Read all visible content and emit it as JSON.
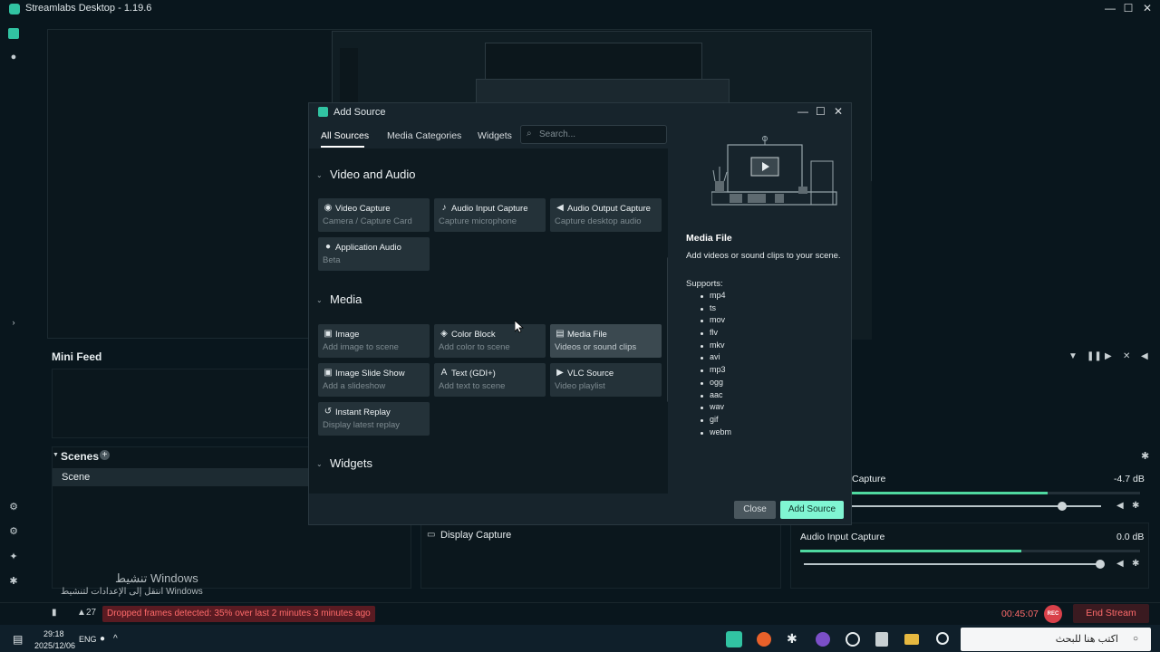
{
  "window": {
    "title": "Streamlabs Desktop - 1.19.6",
    "minimize": "—",
    "maximize": "☐",
    "close": "✕"
  },
  "mini_feed": {
    "title": "Mini Feed"
  },
  "scenes": {
    "title": "Scenes",
    "items": [
      "Scene"
    ]
  },
  "sources_preview": {
    "item": "Display Capture"
  },
  "mixer": {
    "items": [
      {
        "label": "Capture",
        "db": "-4.7 dB",
        "level": 0.68
      },
      {
        "label": "Audio Input Capture",
        "db": "0.0 dB",
        "level": 0.65
      }
    ]
  },
  "status": {
    "dropped_count": "27",
    "dropped_message": "Dropped frames detected: 35% over last 2 minutes 3 minutes ago",
    "rec_time": "00:45:07",
    "rec_label": "REC",
    "end_stream": "End Stream"
  },
  "watermark": {
    "line1": "تنشيط Windows",
    "line2": "انتقل إلى الإعدادات لتنشيط Windows"
  },
  "taskbar": {
    "time": "29:18",
    "date": "2025/12/06",
    "lang": "ENG",
    "search_placeholder": "اكتب هنا للبحث"
  },
  "dialog": {
    "title": "Add Source",
    "tabs": [
      "All Sources",
      "Media Categories",
      "Widgets"
    ],
    "active_tab": 0,
    "search_placeholder": "Search...",
    "sections": [
      {
        "title": "Video and Audio",
        "cards": [
          {
            "name": "Video Capture",
            "desc": "Camera / Capture Card",
            "icon": "camera-icon"
          },
          {
            "name": "Audio Input Capture",
            "desc": "Capture microphone",
            "icon": "microphone-icon"
          },
          {
            "name": "Audio Output Capture",
            "desc": "Capture desktop audio",
            "icon": "speaker-icon"
          },
          {
            "name": "Application Audio",
            "desc": "Beta",
            "icon": "user-icon"
          }
        ]
      },
      {
        "title": "Media",
        "cards": [
          {
            "name": "Image",
            "desc": "Add image to scene",
            "icon": "image-icon"
          },
          {
            "name": "Color Block",
            "desc": "Add color to scene",
            "icon": "paint-bucket-icon"
          },
          {
            "name": "Media File",
            "desc": "Videos or sound clips",
            "icon": "file-icon",
            "active": true
          },
          {
            "name": "Image Slide Show",
            "desc": "Add a slideshow",
            "icon": "images-icon"
          },
          {
            "name": "Text (GDI+)",
            "desc": "Add text to scene",
            "icon": "text-icon"
          },
          {
            "name": "VLC Source",
            "desc": "Video playlist",
            "icon": "play-icon"
          },
          {
            "name": "Instant Replay",
            "desc": "Display latest replay",
            "icon": "replay-icon"
          }
        ]
      },
      {
        "title": "Widgets",
        "cards": []
      }
    ],
    "info": {
      "title": "Media File",
      "description": "Add videos or sound clips to your scene.",
      "supports_label": "Supports:",
      "formats": [
        "mp4",
        "ts",
        "mov",
        "flv",
        "mkv",
        "avi",
        "mp3",
        "ogg",
        "aac",
        "wav",
        "gif",
        "webm"
      ]
    },
    "buttons": {
      "close": "Close",
      "add": "Add Source"
    }
  }
}
